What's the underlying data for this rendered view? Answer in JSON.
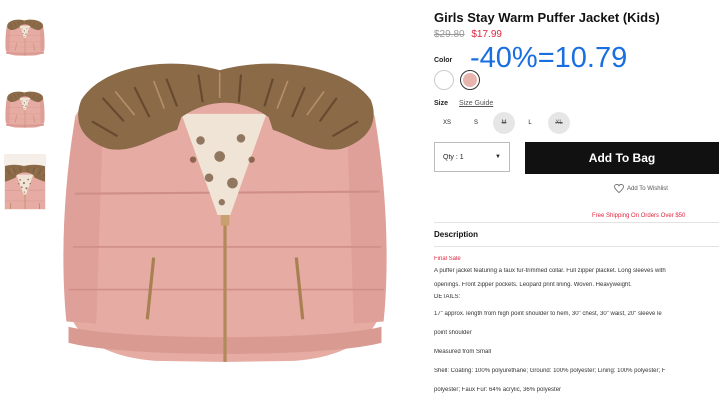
{
  "product": {
    "title": "Girls Stay Warm Puffer Jacket (Kids)",
    "old_price": "$29.80",
    "sale_price": "$17.99",
    "discount_overlay": "-40%=10.79"
  },
  "color": {
    "label": "Color",
    "swatches": [
      {
        "name": "White",
        "hex": "#ffffff",
        "selected": false
      },
      {
        "name": "Pink",
        "hex": "#e8b4ae",
        "selected": true
      }
    ]
  },
  "size": {
    "label": "Size",
    "guide_label": "Size Guide",
    "options": [
      "XS",
      "S",
      "M",
      "L",
      "XL"
    ],
    "out_of_stock": [
      "M",
      "XL"
    ]
  },
  "quantity": {
    "label": "Qty : 1"
  },
  "cart": {
    "add_label": "Add To Bag"
  },
  "wishlist": {
    "label": "Add To Wishlist"
  },
  "shipping": {
    "label": "Free Shipping On Orders Over $50"
  },
  "description": {
    "title": "Description",
    "sale_tag": "Final Sale",
    "lines": [
      "A puffer jacket featuring a faux fur-trimmed collar. Full zipper placket. Long sleeves with",
      "openings. Front zipper pockets. Leopard print lining. Woven. Heavyweight.",
      "DETAILS:",
      "17\" approx. length from high point shoulder to hem, 30\" chest, 30\" waist, 20\" sleeve le",
      "point shoulder",
      "Measured from Small",
      "Shell: Coating: 100% polyurethane; Ground: 100% polyester; Lining: 100% polyester; F",
      "polyester; Faux Fur: 64% acrylic, 36% polyester"
    ]
  },
  "colors": {
    "sale": "#e0263d",
    "overlay": "#1a6fe0",
    "button": "#111111",
    "jacket": "#e8b4ae",
    "fur": "#8b6a48"
  }
}
